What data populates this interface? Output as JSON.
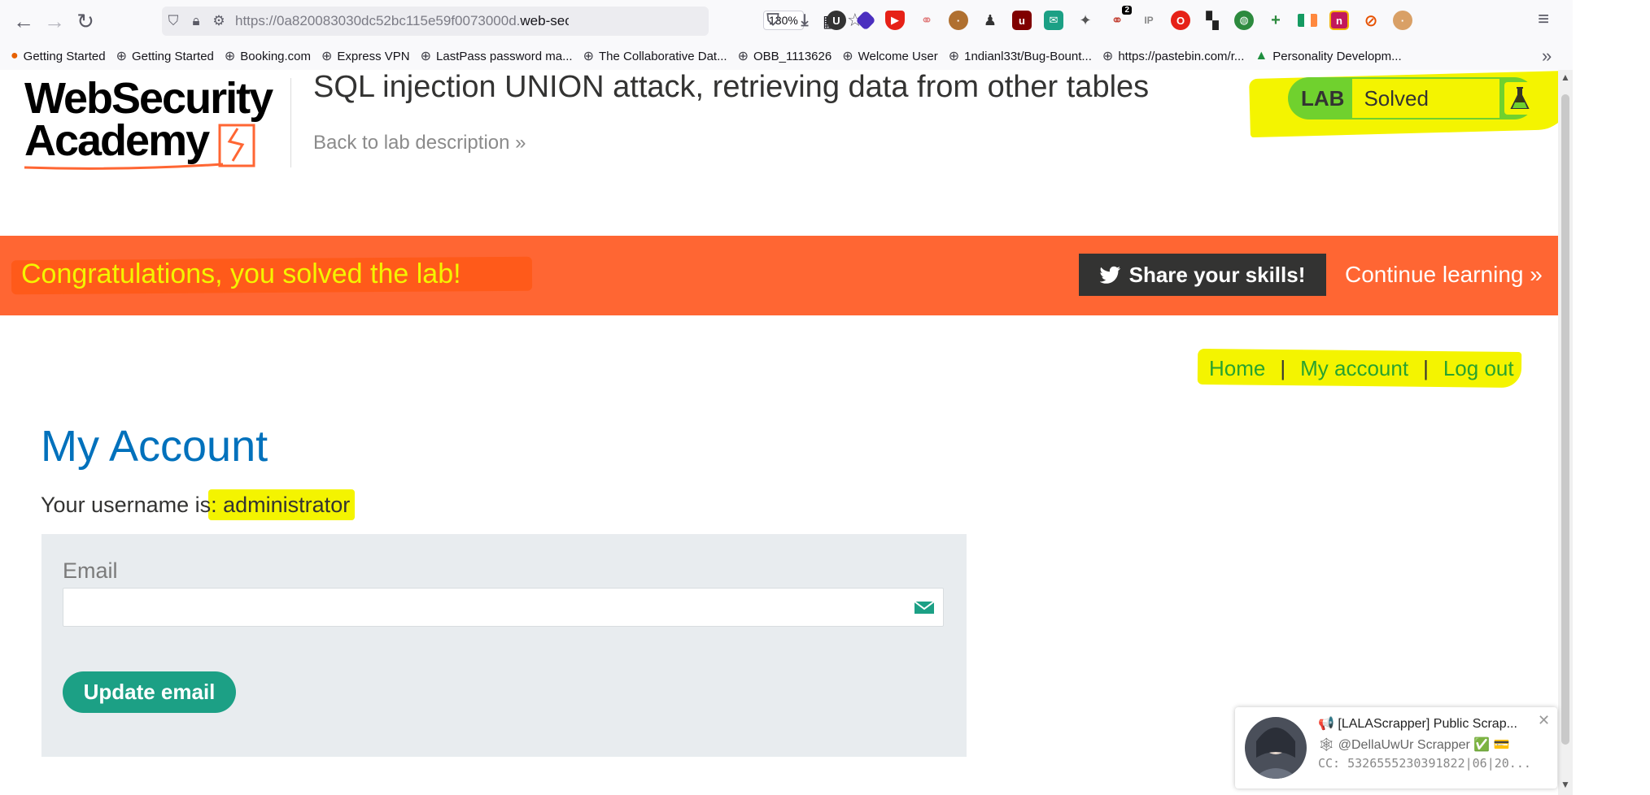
{
  "browser": {
    "url_prefix": "https://0a820083030dc52bc115e59f0073000d.",
    "url_domain": "web-sec",
    "zoom": "130%",
    "extension_icons": [
      "pocket-icon",
      "download-icon",
      "u-extension-icon",
      "layers-extension-icon",
      "youtube-extension-icon",
      "link-extension-icon",
      "cookie-extension-icon",
      "spy-extension-icon",
      "ublock-icon",
      "tempmail-icon",
      "puzzle-extension-icon",
      "cookie-count-extension-icon",
      "ip-extension-icon",
      "opera-extension-icon",
      "grid-extension-icon",
      "globe-extension-icon",
      "plus-extension-icon",
      "flag-extension-icon",
      "n-extension-icon",
      "blocked-extension-icon",
      "color-picker-extension-icon"
    ],
    "cookie_badge": "2",
    "ip_label": "IP",
    "bookmarks": [
      {
        "label": "Getting Started",
        "icon": "firefox-icon"
      },
      {
        "label": "Getting Started",
        "icon": "globe-icon"
      },
      {
        "label": "Booking.com",
        "icon": "globe-icon"
      },
      {
        "label": "Express VPN",
        "icon": "globe-icon"
      },
      {
        "label": "LastPass password ma...",
        "icon": "globe-icon"
      },
      {
        "label": "The Collaborative Dat...",
        "icon": "globe-icon"
      },
      {
        "label": "OBB_1113626",
        "icon": "globe-icon"
      },
      {
        "label": "Welcome User",
        "icon": "globe-icon"
      },
      {
        "label": "1ndianl33t/Bug-Bount...",
        "icon": "globe-icon"
      },
      {
        "label": "https://pastebin.com/r...",
        "icon": "globe-icon"
      },
      {
        "label": "Personality Developm...",
        "icon": "drive-icon"
      }
    ]
  },
  "header": {
    "logo_line1": "WebSecurity",
    "logo_line2": "Academy",
    "title": "SQL injection UNION attack, retrieving data from other tables",
    "back_link": "Back to lab description",
    "lab_label": "LAB",
    "lab_status": "Solved"
  },
  "banner": {
    "message": "Congratulations, you solved the lab!",
    "share_label": "Share your skills!",
    "continue_label": "Continue learning"
  },
  "nav": {
    "home": "Home",
    "my_account": "My account",
    "log_out": "Log out",
    "separator": "|"
  },
  "account": {
    "heading": "My Account",
    "username_prefix": "Your username is:",
    "username": "administrator",
    "email_label": "Email",
    "email_value": "",
    "update_button": "Update email"
  },
  "notification": {
    "title": "📢 [LALAScrapper] Public Scrap...",
    "subtitle": "🕸 @DellaUwUr Scrapper ✅ 💳",
    "body": "CC: 5326555230391822|06|20..."
  },
  "colors": {
    "brand_orange": "#ff6633",
    "highlight_yellow": "#f4f400",
    "lab_green": "#70d12e",
    "link_blue": "#0071bc",
    "button_teal": "#1ca085"
  }
}
